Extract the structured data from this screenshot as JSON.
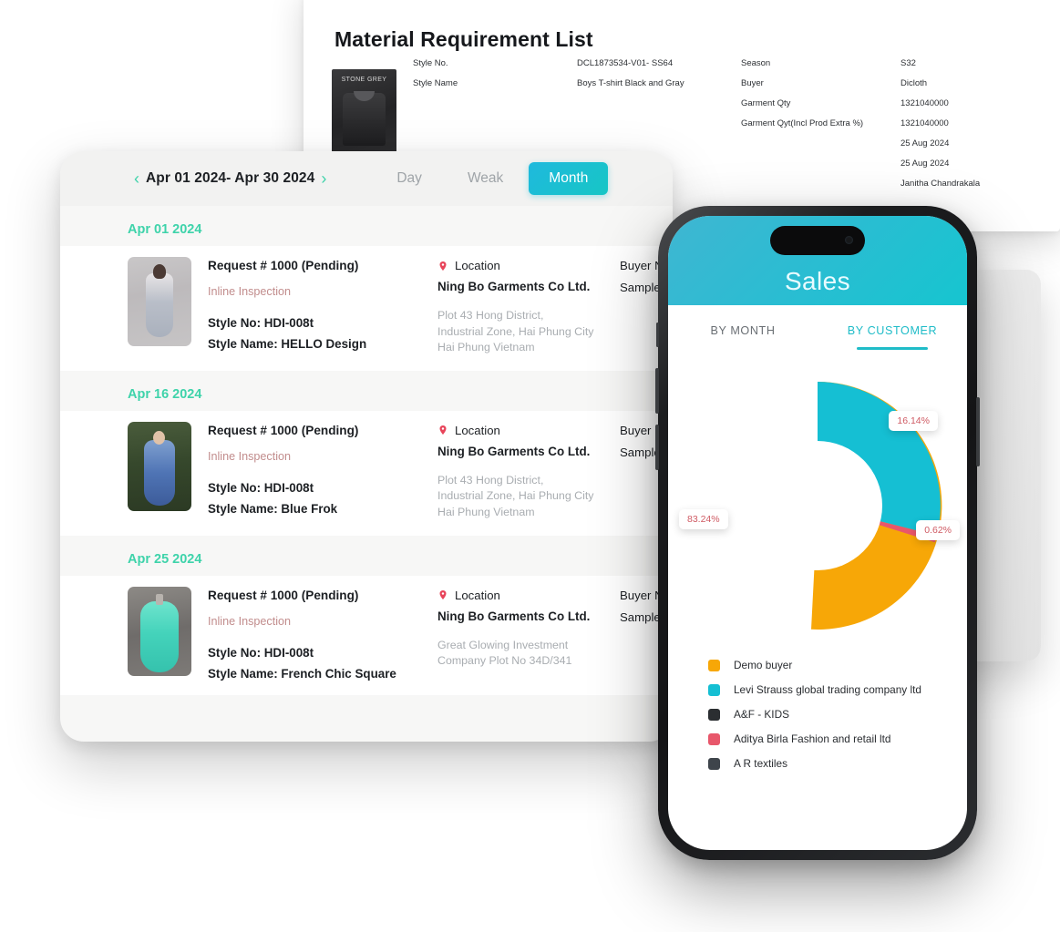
{
  "document": {
    "title": "Material Requirement List",
    "thumb_label": "STONE GREY",
    "left_rows": [
      {
        "key": "Style No.",
        "value": "DCL1873534-V01- SS64"
      },
      {
        "key": "Style Name",
        "value": "Boys T-shirt Black and Gray"
      }
    ],
    "right_rows": [
      {
        "key": "Season",
        "value": "S32"
      },
      {
        "key": "Buyer",
        "value": "Dicloth"
      },
      {
        "key": "Garment Qty",
        "value": "1321040000"
      },
      {
        "key": "Garment Qyt(Incl Prod Extra %)",
        "value": "1321040000"
      },
      {
        "key": "",
        "value": "25 Aug 2024"
      },
      {
        "key": "",
        "value": "25 Aug 2024"
      },
      {
        "key": "",
        "value": "Janitha Chandrakala"
      }
    ]
  },
  "tablet": {
    "toolbar": {
      "prev_icon": "chevron-left-icon",
      "next_icon": "chevron-right-icon",
      "date_range": "Apr 01 2024- Apr 30 2024",
      "segments": [
        {
          "label": "Day",
          "active": false
        },
        {
          "label": "Weak",
          "active": false
        },
        {
          "label": "Month",
          "active": true
        }
      ]
    },
    "groups": [
      {
        "date": "Apr 01 2024",
        "entry": {
          "request": "Request # 1000 (Pending)",
          "inspection": "Inline Inspection",
          "style_no": "Style No: HDI-008t",
          "style_name": "Style Name: HELLO Design",
          "location_label": "Location",
          "location_name": "Ning Bo Garments Co Ltd.",
          "address": "Plot 43 Hong District,\nIndustrial Zone, Hai Phung City\nHai Phung Vietnam",
          "buyer_label": "Buyer Name",
          "sample_ref_label": "Sample Ref."
        }
      },
      {
        "date": "Apr 16 2024",
        "entry": {
          "request": "Request # 1000 (Pending)",
          "inspection": "Inline Inspection",
          "style_no": "Style No: HDI-008t",
          "style_name": "Style Name: Blue Frok",
          "location_label": "Location",
          "location_name": "Ning Bo Garments Co Ltd.",
          "address": "Plot 43 Hong District,\nIndustrial Zone, Hai Phung City\nHai Phung Vietnam",
          "buyer_label": "Buyer Name",
          "sample_ref_label": "Sample Ref."
        }
      },
      {
        "date": "Apr 25 2024",
        "entry": {
          "request": "Request # 1000 (Pending)",
          "inspection": "Inline Inspection",
          "style_no": "Style No: HDI-008t",
          "style_name": "Style Name: French Chic Square",
          "location_label": "Location",
          "location_name": "Ning Bo Garments Co Ltd.",
          "address": "Great Glowing Investment\nCompany Plot No 34D/341",
          "buyer_label": "Buyer Name",
          "sample_ref_label": "Sample Ref."
        }
      }
    ]
  },
  "phone": {
    "title": "Sales",
    "tabs": [
      {
        "label": "BY MONTH",
        "active": false
      },
      {
        "label": "BY CUSTOMER",
        "active": true
      }
    ],
    "labels": {
      "slice_a": "83.24%",
      "slice_b": "16.14%",
      "slice_c": "0.62%"
    },
    "legend": [
      {
        "label": "Demo buyer",
        "color": "#F7A707"
      },
      {
        "label": "Levi Strauss global trading company ltd",
        "color": "#15BFD3"
      },
      {
        "label": "A&F - KIDS",
        "color": "#2B2E31"
      },
      {
        "label": "Aditya Birla Fashion and retail ltd",
        "color": "#E8576B"
      },
      {
        "label": "A R textiles",
        "color": "#3E444B"
      }
    ]
  },
  "chart_data": {
    "type": "pie",
    "title": "Sales by Customer",
    "legend_position": "bottom",
    "categories": [
      "Demo buyer",
      "Levi Strauss global trading company ltd",
      "A&F - KIDS",
      "Aditya Birla Fashion and retail ltd",
      "A R textiles"
    ],
    "values": [
      83.24,
      16.14,
      0.0,
      0.62,
      0.0
    ],
    "value_labels": [
      "83.24%",
      "16.14%",
      "",
      "0.62%",
      ""
    ],
    "colors": [
      "#F7A707",
      "#15BFD3",
      "#2B2E31",
      "#E8576B",
      "#3E444B"
    ],
    "unit": "%",
    "donut": true,
    "inner_radius_ratio": 0.52
  }
}
